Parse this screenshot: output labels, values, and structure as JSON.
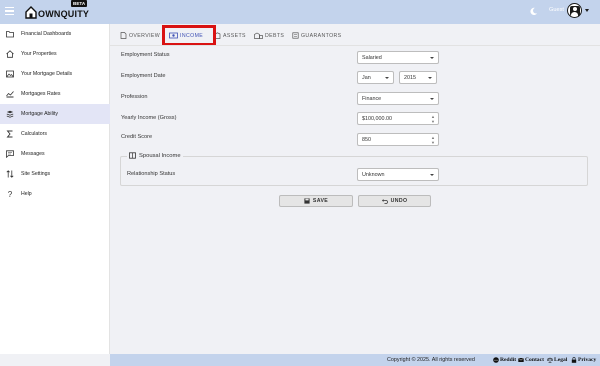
{
  "app": {
    "logo_text": "OWNQUITY",
    "beta_label": "BETA",
    "user_label": "Guest"
  },
  "colors": {
    "topbar": "#c3d3ec",
    "accent": "#3f51b5",
    "highlight": "#d91212",
    "sidebar_active": "#e3e5f6"
  },
  "sidebar": {
    "items": [
      {
        "label": "Financial Dashboards",
        "icon": "folder-icon"
      },
      {
        "label": "Your Properties",
        "icon": "house-icon"
      },
      {
        "label": "Your Mortgage Details",
        "icon": "image-icon"
      },
      {
        "label": "Mortgages Rates",
        "icon": "chart-icon"
      },
      {
        "label": "Mortgage Ability",
        "icon": "stack-icon"
      },
      {
        "label": "Calculators",
        "icon": "sigma-icon"
      },
      {
        "label": "Messages",
        "icon": "message-icon"
      },
      {
        "label": "Site Settings",
        "icon": "sort-icon"
      },
      {
        "label": "Help",
        "icon": "question-icon"
      }
    ],
    "active_item": "Mortgage Ability"
  },
  "tabs": [
    {
      "label": "OVERVIEW",
      "icon": "document-icon"
    },
    {
      "label": "INCOME",
      "icon": "money-icon"
    },
    {
      "label": "ASSETS",
      "icon": "asset-icon"
    },
    {
      "label": "DEBTS",
      "icon": "debt-icon"
    },
    {
      "label": "GUARANTORS",
      "icon": "guarantor-icon"
    }
  ],
  "active_tab": "INCOME",
  "form": {
    "employment_status": {
      "label": "Employment Status",
      "value": "Salaried"
    },
    "employment_date": {
      "label": "Employment Date",
      "month": "Jan",
      "year": "2015"
    },
    "profession": {
      "label": "Profession",
      "value": "Finance"
    },
    "yearly_income": {
      "label": "Yearly Income (Gross)",
      "value": "$100,000.00"
    },
    "credit_score": {
      "label": "Credit Score",
      "value": "850"
    },
    "spousal": {
      "title": "Spousal Income",
      "relationship_label": "Relationship Status",
      "relationship_value": "Unknown"
    }
  },
  "buttons": {
    "save": "SAVE",
    "undo": "UNDO"
  },
  "footer": {
    "copyright": "Copyright © 2025. All rights reserved",
    "links": [
      "Reddit",
      "Contact",
      "Legal",
      "Privacy"
    ]
  }
}
